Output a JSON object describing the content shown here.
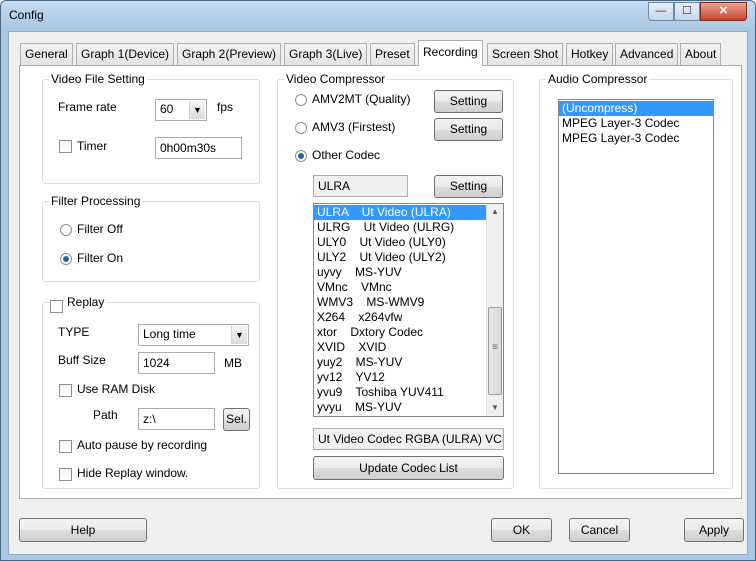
{
  "window": {
    "title": "Config",
    "controls": {
      "min": "—",
      "max": "☐",
      "close": "✕"
    }
  },
  "tabs": [
    "General",
    "Graph 1(Device)",
    "Graph 2(Preview)",
    "Graph 3(Live)",
    "Preset",
    "Recording",
    "Screen Shot",
    "Hotkey",
    "Advanced",
    "About"
  ],
  "active_tab": "Recording",
  "video_file": {
    "legend": "Video File Setting",
    "frame_rate_label": "Frame rate",
    "frame_rate_value": "60",
    "fps_label": "fps",
    "timer_label": "Timer",
    "timer_checked": false,
    "timer_value": "0h00m30s"
  },
  "filter": {
    "legend": "Filter Processing",
    "off_label": "Filter Off",
    "on_label": "Filter On",
    "selected": "Filter On"
  },
  "replay": {
    "legend": "Replay",
    "checked": false,
    "type_label": "TYPE",
    "type_value": "Long time",
    "buff_label": "Buff Size",
    "buff_value": "1024",
    "buff_unit": "MB",
    "ram_disk_label": "Use RAM Disk",
    "path_label": "Path",
    "path_value": "z:\\",
    "sel_button": "Sel.",
    "auto_pause_label": "Auto pause by recording",
    "hide_window_label": "Hide Replay window."
  },
  "video_compressor": {
    "legend": "Video Compressor",
    "options": [
      "AMV2MT (Quality)",
      "AMV3 (Firstest)",
      "Other Codec"
    ],
    "selected": "Other Codec",
    "setting_label": "Setting",
    "codec_field": "ULRA",
    "codecs": [
      "ULRA    Ut Video (ULRA)",
      "ULRG    Ut Video (ULRG)",
      "ULY0    Ut Video (ULY0)",
      "ULY2    Ut Video (ULY2)",
      "uyvy    MS-YUV",
      "VMnc    VMnc",
      "WMV3    MS-WMV9",
      "X264    x264vfw",
      "xtor    Dxtory Codec",
      "XVID    XVID",
      "yuy2    MS-YUV",
      "yv12    YV12",
      "yvu9    Toshiba YUV411",
      "yvyu    MS-YUV"
    ],
    "selected_codec_index": 0,
    "codec_description": "Ut Video Codec RGBA (ULRA) VCM",
    "update_button": "Update Codec List"
  },
  "audio_compressor": {
    "legend": "Audio Compressor",
    "items": [
      "(Uncompress)",
      "MPEG Layer-3 Codec",
      "MPEG Layer-3 Codec"
    ],
    "selected_index": 0
  },
  "buttons": {
    "help": "Help",
    "ok": "OK",
    "cancel": "Cancel",
    "apply": "Apply"
  },
  "icons": {
    "combo_arrow": "▼",
    "scroll_up": "▲",
    "scroll_down": "▼",
    "scroll_grip": "≡"
  }
}
